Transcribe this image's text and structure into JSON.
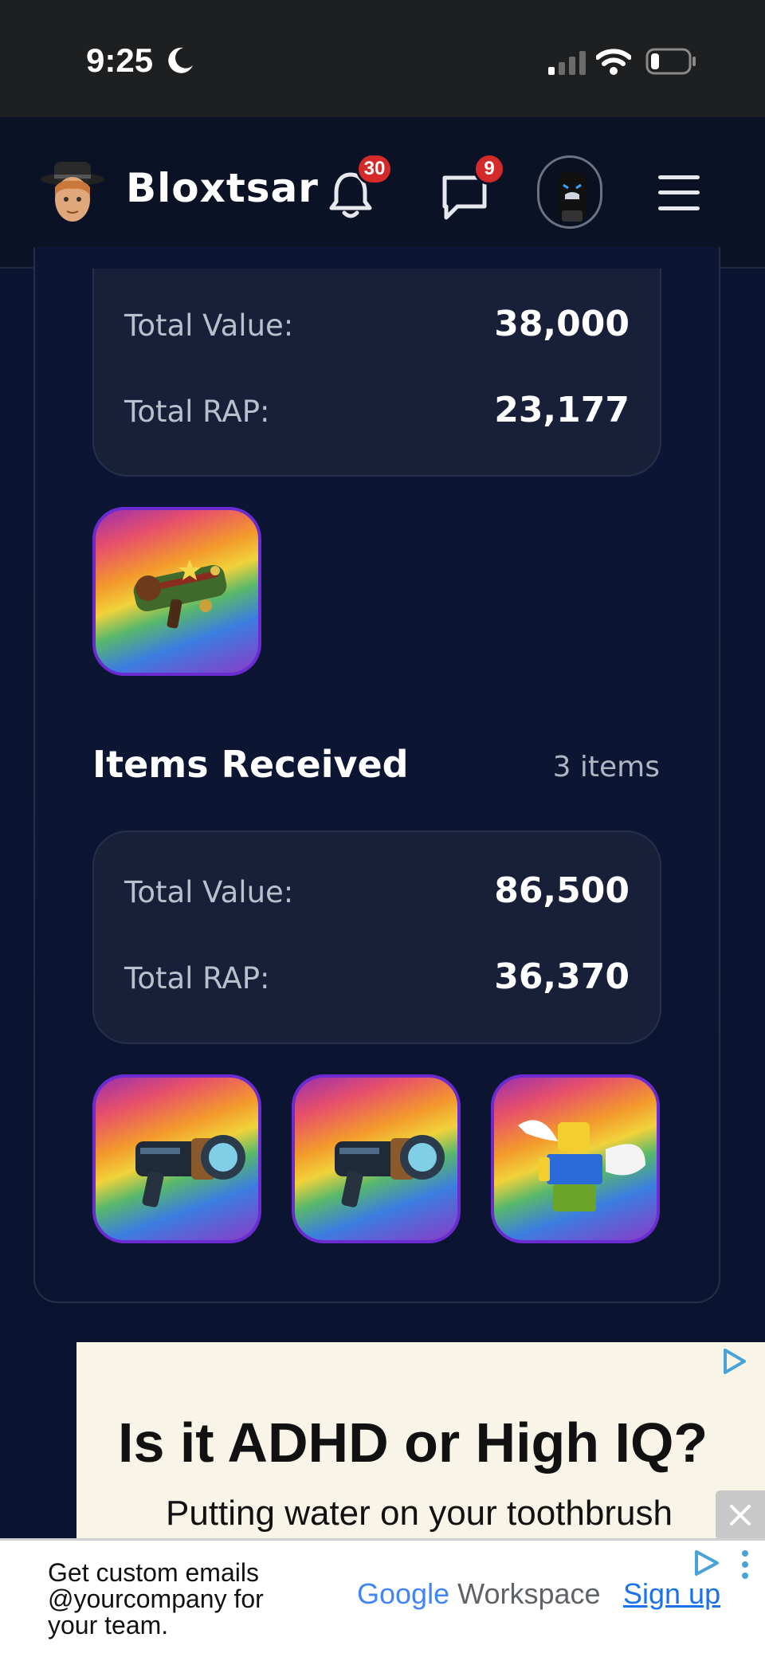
{
  "status_bar": {
    "time": "9:25"
  },
  "header": {
    "brand": "Bloxtsar",
    "notifications_count": "30",
    "messages_count": "9"
  },
  "sent": {
    "total_value_label": "Total Value:",
    "total_value": "38,000",
    "total_rap_label": "Total RAP:",
    "total_rap": "23,177",
    "items": [
      {
        "icon": "rainbow-bazooka-item-icon"
      }
    ]
  },
  "received": {
    "title": "Items Received",
    "count": "3 items",
    "total_value_label": "Total Value:",
    "total_value": "86,500",
    "total_rap_label": "Total RAP:",
    "total_rap": "36,370",
    "items": [
      {
        "icon": "blaster-item-icon"
      },
      {
        "icon": "blaster-item-icon"
      },
      {
        "icon": "winged-avatar-item-icon"
      }
    ]
  },
  "ad_banner": {
    "headline": "Is it ADHD or High IQ?",
    "subline": "Putting water on your toothbrush"
  },
  "ad_footer": {
    "copy": "Get custom emails @yourcompany for your team.",
    "brand_google": "Google",
    "brand_workspace": "Workspace",
    "cta": "Sign up"
  },
  "colors": {
    "background": "#0a1330",
    "card": "#172038",
    "badge": "#d42a2a",
    "cta": "#1a73e8"
  }
}
